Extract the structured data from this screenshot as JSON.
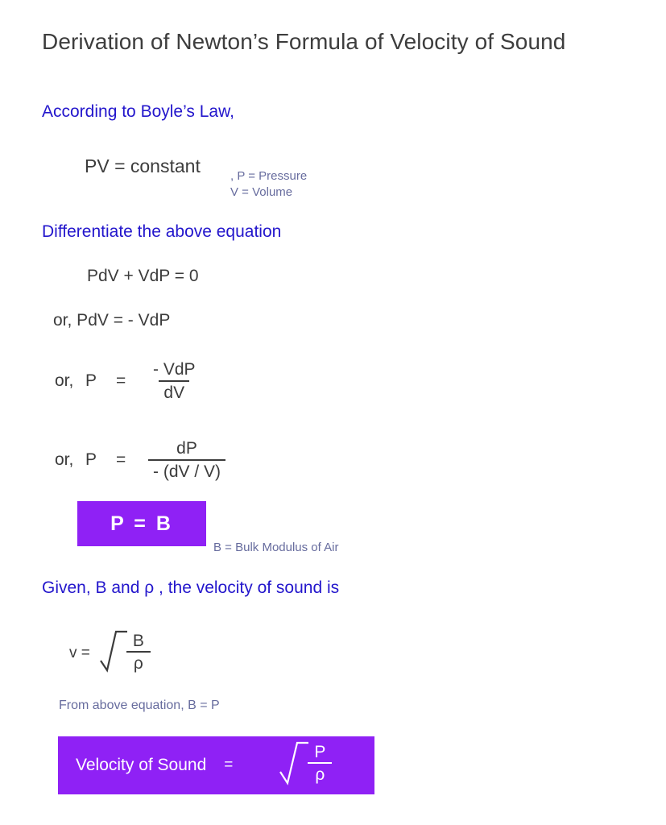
{
  "document": {
    "title": "Derivation of Newton’s Formula of Velocity of Sound",
    "background_color": "#ffffff"
  },
  "colors": {
    "title_text": "#3d3d3d",
    "statement_blue": "#2316cc",
    "math_dark": "#3c3c3c",
    "annotation_gray_purple": "#676c9e",
    "highlight_purple": "#8f21f5",
    "highlight_text": "#ffffff"
  },
  "sections": {
    "boyle": {
      "heading": "According to Boyle’s Law,",
      "equation": "PV = constant",
      "annotation_line1": ", P = Pressure",
      "annotation_line2": "V = Volume"
    },
    "differentiate": {
      "heading": "Differentiate the above equation",
      "step1": "PdV + VdP = 0",
      "step2": "or,   PdV  =  - VdP",
      "step3": {
        "prefix_or": "or,",
        "lhs": "P",
        "equals": "=",
        "numerator": "- VdP",
        "denominator": "dV"
      },
      "step4": {
        "prefix_or": "or,",
        "lhs": "P",
        "equals": "=",
        "numerator": "dP",
        "denominator": "- (dV / V)"
      }
    },
    "result_box": {
      "expression": "P  =  B",
      "annotation": "B = Bulk Modulus of Air"
    },
    "velocity": {
      "heading": "Given, B and ρ , the velocity of sound is",
      "formula": {
        "lhs": "v =",
        "numerator": "B",
        "denominator": "ρ"
      },
      "note": "From above equation, B = P"
    },
    "final_box": {
      "label": "Velocity of Sound",
      "equals": "=",
      "numerator": "P",
      "denominator": "ρ"
    }
  }
}
